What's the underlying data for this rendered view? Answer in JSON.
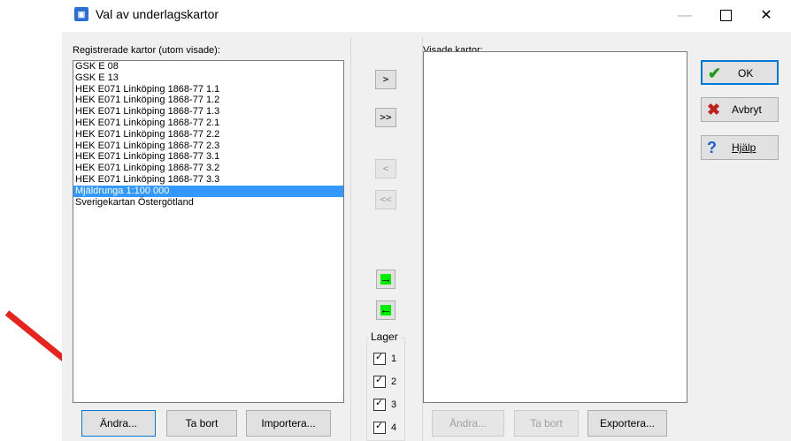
{
  "window": {
    "title": "Val av underlagskartor",
    "app_icon": "map-app-icon"
  },
  "left": {
    "label": "Registrerade kartor (utom visade):",
    "items": [
      "GSK E 08",
      "GSK E 13",
      "HEK E071 Linköping 1868-77 1.1",
      "HEK E071 Linköping 1868-77 1.2",
      "HEK E071 Linköping 1868-77 1.3",
      "HEK E071 Linköping 1868-77 2.1",
      "HEK E071 Linköping 1868-77 2.2",
      "HEK E071 Linköping 1868-77 2.3",
      "HEK E071 Linköping 1868-77 3.1",
      "HEK E071 Linköping 1868-77 3.2",
      "HEK E071 Linköping 1868-77 3.3",
      "Mjäldrunga 1:100 000",
      "Sverigekartan Östergötland"
    ],
    "selected_index": 11,
    "buttons": {
      "edit": "Ändra...",
      "remove": "Ta bort",
      "import": "Importera..."
    }
  },
  "middle": {
    "move_one": ">",
    "move_all": ">>",
    "back_one": "<",
    "back_all": "<<",
    "layers_title": "Lager",
    "layers": [
      {
        "label": "1",
        "checked": true
      },
      {
        "label": "2",
        "checked": true
      },
      {
        "label": "3",
        "checked": true
      },
      {
        "label": "4",
        "checked": true
      }
    ]
  },
  "right": {
    "label": "Visade kartor:",
    "buttons": {
      "edit": "Ändra...",
      "remove": "Ta bort",
      "export": "Exportera..."
    }
  },
  "side": {
    "ok": "OK",
    "cancel": "Avbryt",
    "help": "Hjälp"
  },
  "colors": {
    "selection": "#3399ff",
    "focus": "#0078d7",
    "annotation_arrow": "#e8231b",
    "ok_check": "#1a9e1a",
    "cancel_x": "#c0201a",
    "help_q": "#1a5fd0"
  }
}
